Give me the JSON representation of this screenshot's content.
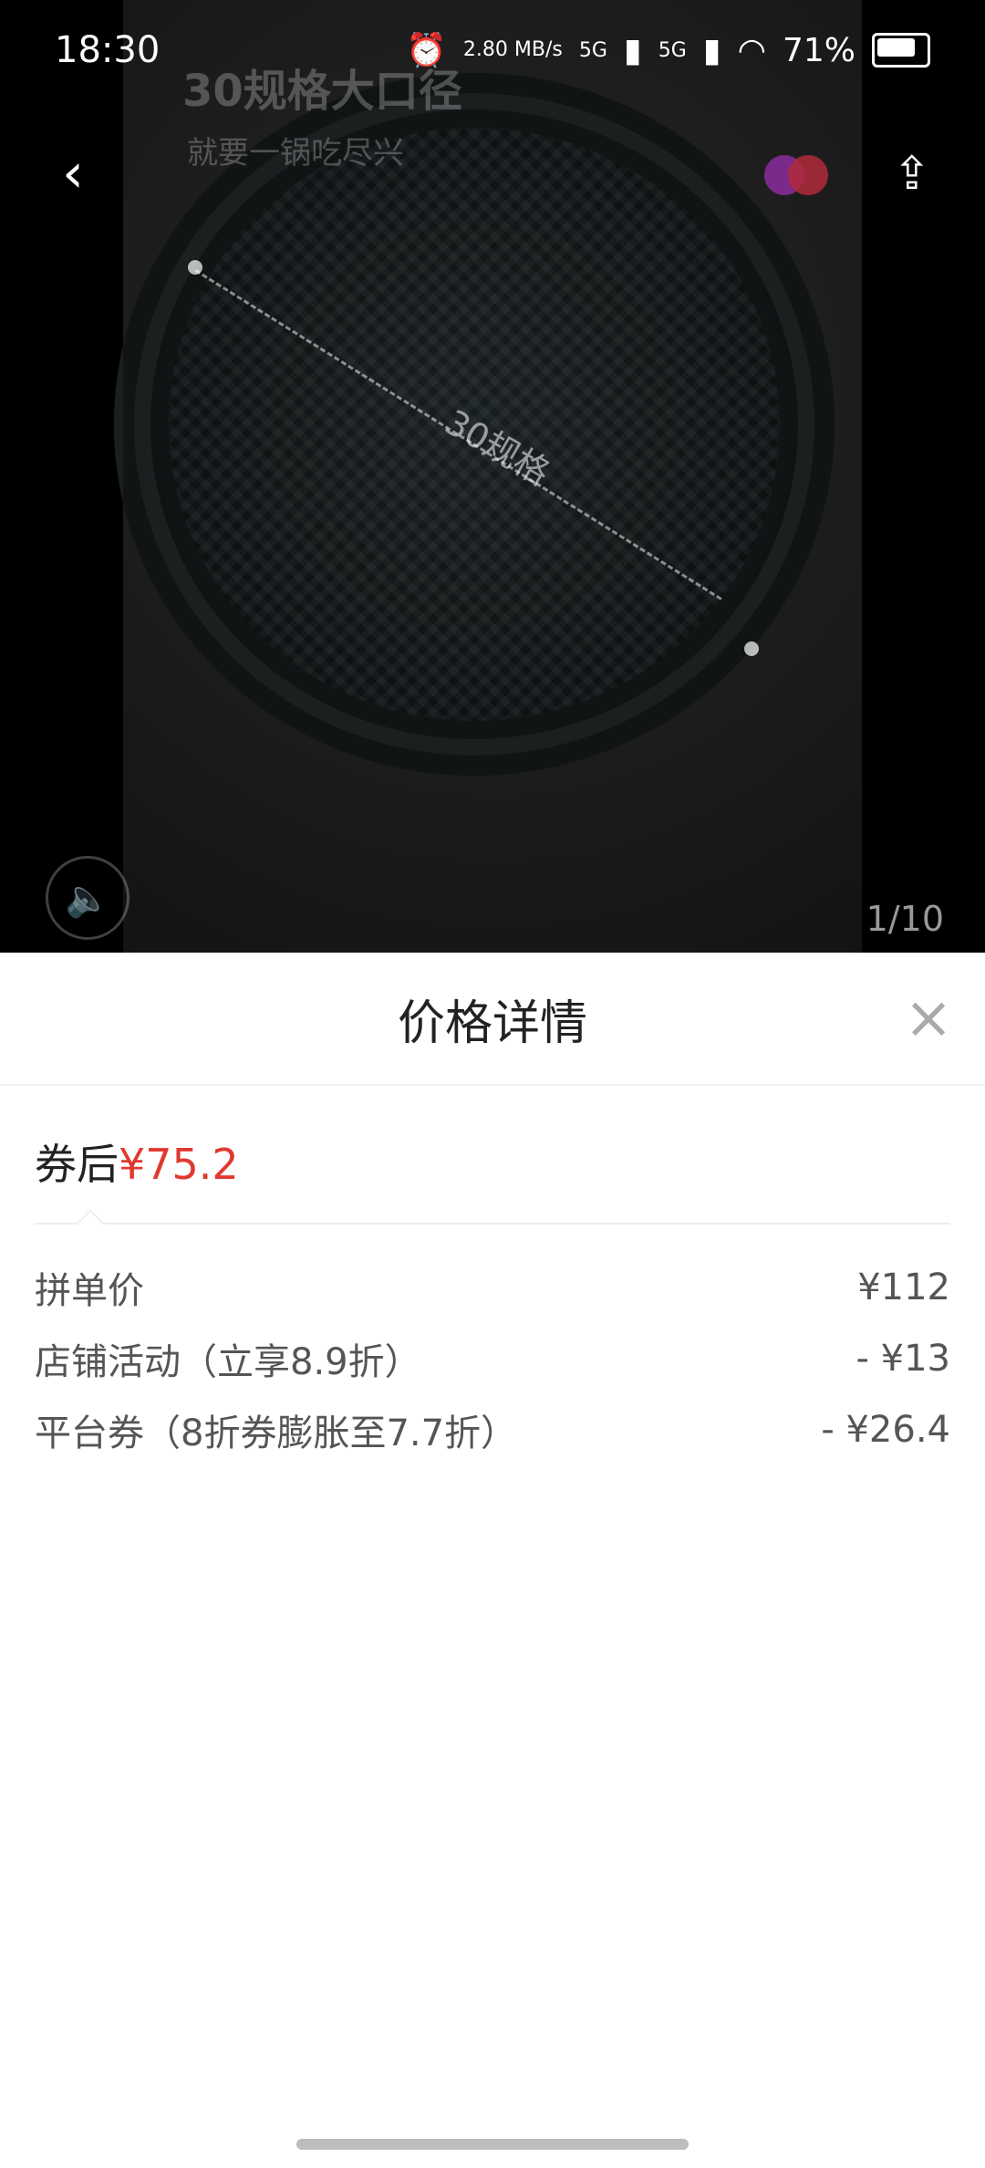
{
  "status_bar": {
    "time": "18:30",
    "network_speed": "2.80 MB/s",
    "signal1": "5G",
    "signal2": "5G",
    "battery": "71%"
  },
  "gallery": {
    "overlay_title": "30规格大口径",
    "overlay_subtitle": "就要一锅吃尽兴",
    "pan_label": "30规格",
    "page_indicator": "1/10",
    "icons": {
      "back": "back-icon",
      "share": "share-icon",
      "sound": "speaker-icon"
    }
  },
  "sheet": {
    "title": "价格详情",
    "close_icon": "close-icon",
    "final_label": "券后",
    "final_price": "¥75.2",
    "accent_color": "#e0392f",
    "items": [
      {
        "label": "拼单价",
        "value": "¥112"
      },
      {
        "label": "店铺活动（立享8.9折）",
        "value": "- ¥13"
      },
      {
        "label": "平台券（8折券膨胀至7.7折）",
        "value": "- ¥26.4"
      }
    ]
  }
}
